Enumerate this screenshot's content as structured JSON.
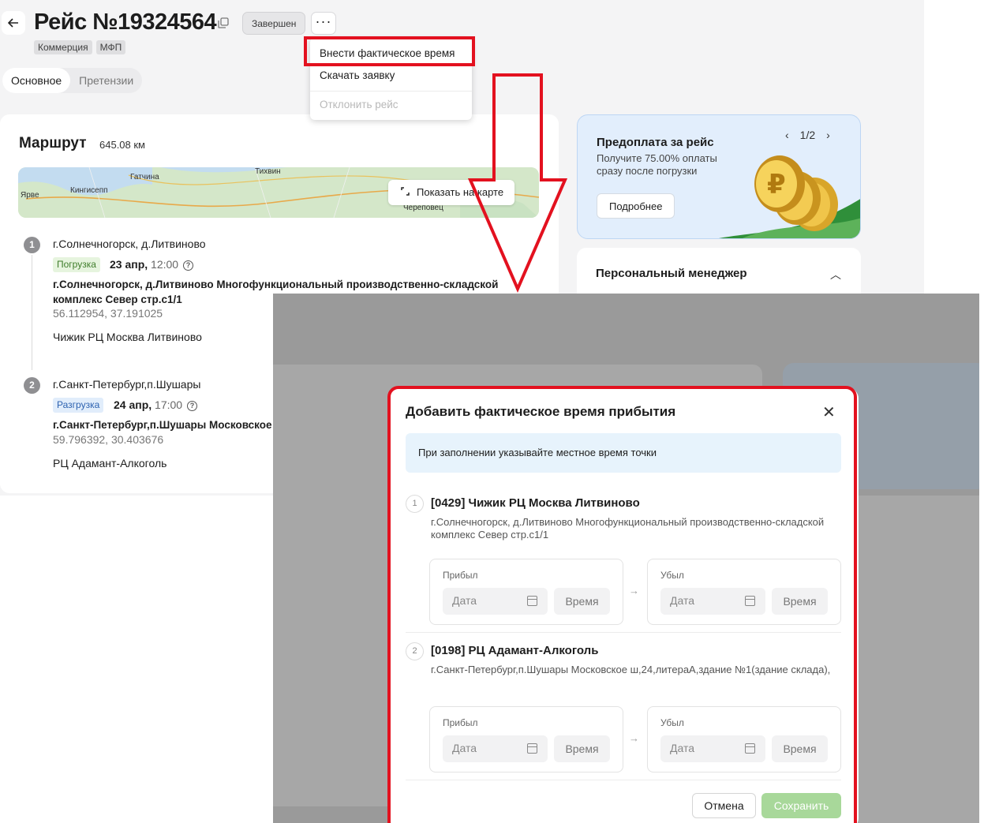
{
  "header": {
    "title": "Рейс №19324564",
    "status": "Завершен",
    "more": "···",
    "tags": [
      "Коммерция",
      "МФП"
    ]
  },
  "tabs": [
    "Основное",
    "Претензии"
  ],
  "menu": {
    "items": [
      "Внести фактическое время",
      "Скачать заявку",
      "Отклонить рейс"
    ]
  },
  "route": {
    "title": "Маршрут",
    "distance": "645.08 км",
    "map_button": "Показать на карте",
    "map_labels": [
      "Тихвин",
      "Гатчина",
      "Кингисепп",
      "Ярве",
      "Череповец"
    ],
    "points": [
      {
        "num": "1",
        "city": "г.Солнечногорск, д.Литвиново",
        "badge": "Погрузка",
        "date": "23 апр,",
        "time": "12:00",
        "address": "г.Солнечногорск, д.Литвиново Многофункциональный производственно-складской комплекс Север стр.с1/1",
        "coords": "56.112954, 37.191025",
        "name": "Чижик РЦ Москва Литвиново"
      },
      {
        "num": "2",
        "city": "г.Санкт-Петербург,п.Шушары",
        "badge": "Разгрузка",
        "date": "24 апр,",
        "time": "17:00",
        "address": "г.Санкт-Петербург,п.Шушары Московское",
        "coords": "59.796392, 30.403676",
        "name": "РЦ Адамант-Алкоголь"
      }
    ]
  },
  "promo": {
    "title": "Предоплата за рейс",
    "text": "Получите 75.00% оплаты сразу после погрузки",
    "button": "Подробнее",
    "pager": "1/2"
  },
  "manager": {
    "title": "Персональный менеджер"
  },
  "modal": {
    "title": "Добавить фактическое время прибытия",
    "info": "При заполнении указывайте местное время точки",
    "points": [
      {
        "num": "1",
        "name": "[0429] Чижик РЦ Москва Литвиново",
        "address": "г.Солнечногорск, д.Литвиново Многофункциональный производственно-складской комплекс Север стр.с1/1"
      },
      {
        "num": "2",
        "name": "[0198] РЦ Адамант-Алкоголь",
        "address": "г.Санкт-Петербург,п.Шушары Московское ш,24,литераА,здание №1(здание склада),"
      }
    ],
    "arrived_label": "Прибыл",
    "departed_label": "Убыл",
    "date_placeholder": "Дата",
    "time_placeholder": "Время",
    "cancel": "Отмена",
    "save": "Сохранить"
  },
  "colors": {
    "highlight": "#e3111f",
    "save_disabled": "#a8d89a",
    "info_bg": "#e7f3fc"
  }
}
